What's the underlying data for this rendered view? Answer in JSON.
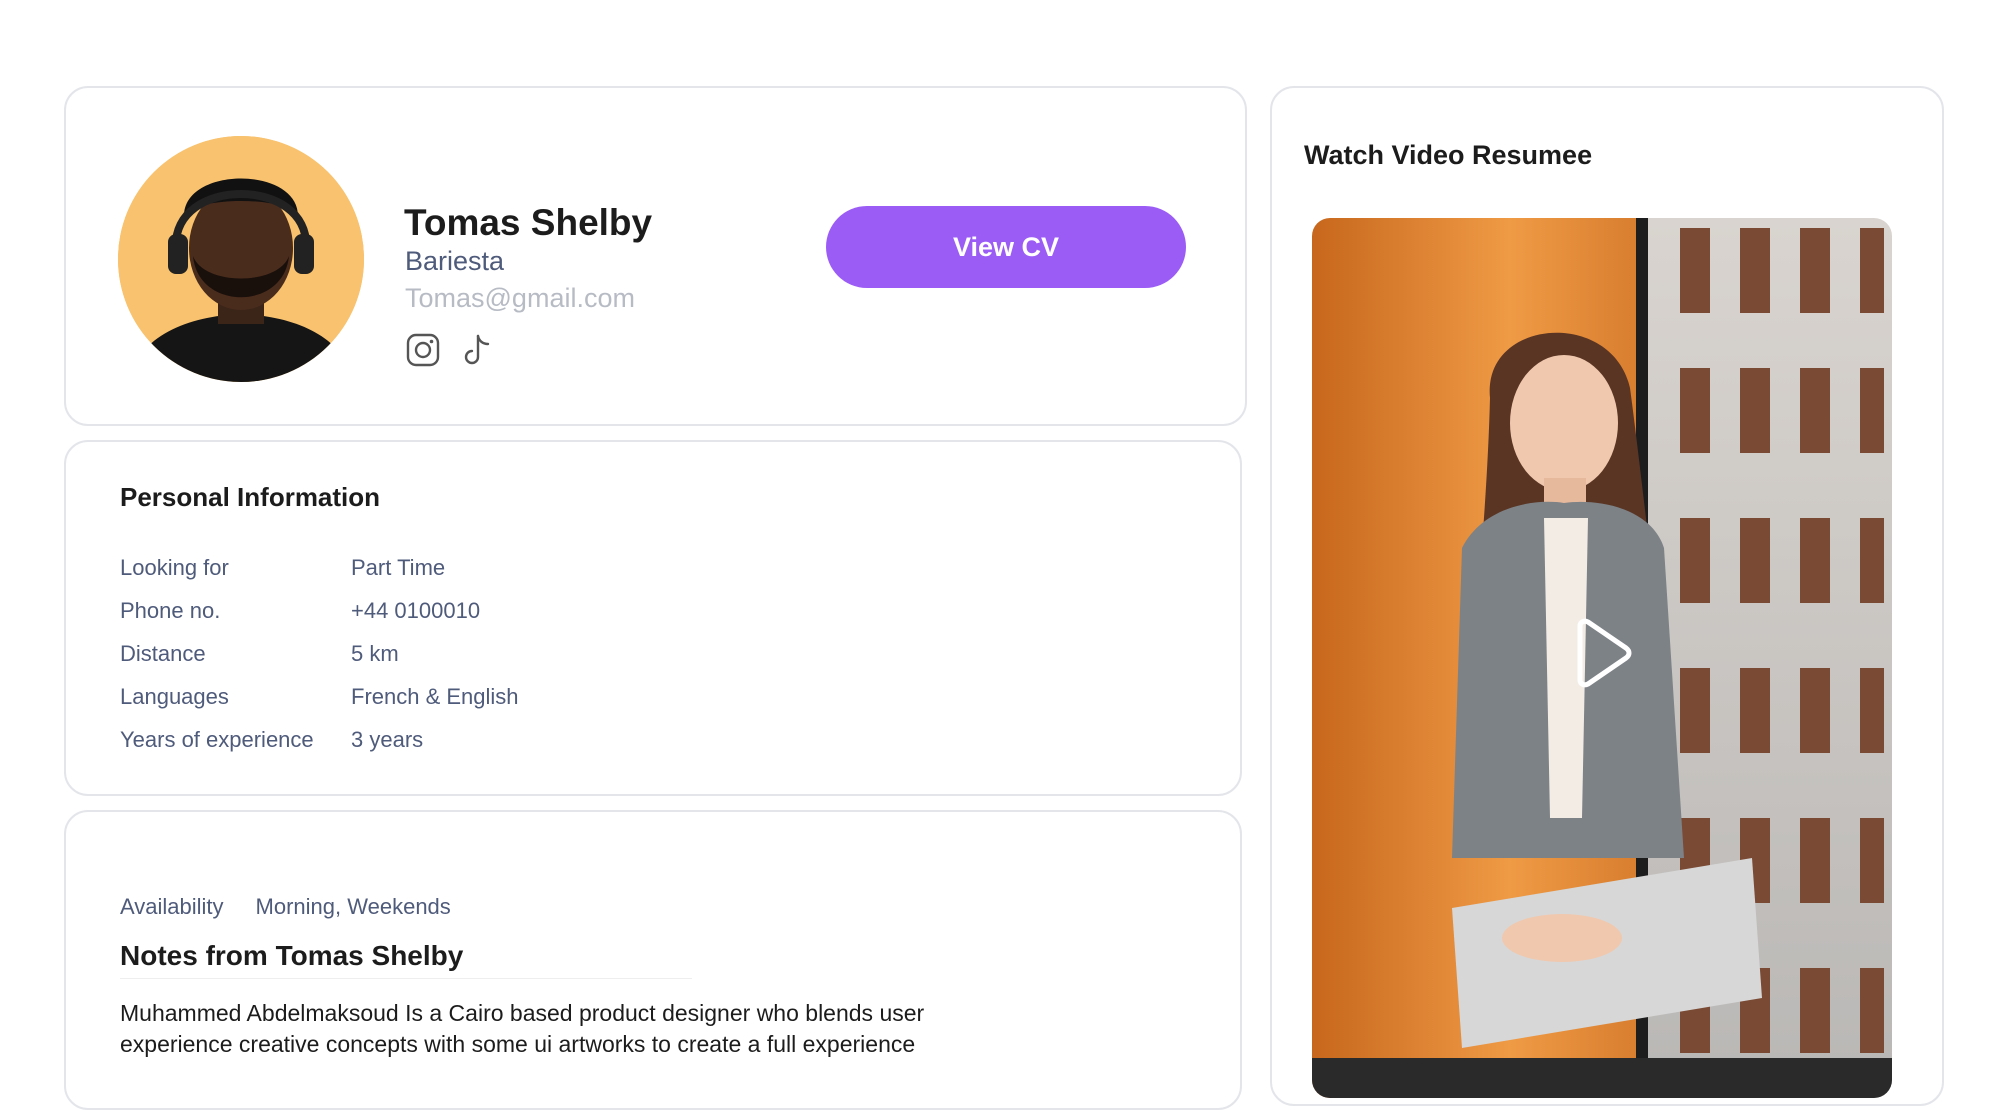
{
  "profile": {
    "name": "Tomas Shelby",
    "role": "Bariesta",
    "email": "Tomas@gmail.com",
    "view_cv_label": "View CV",
    "avatar_icon": "avatar-photo",
    "social_icons": [
      "instagram-icon",
      "tiktok-icon"
    ]
  },
  "personal_info": {
    "title": "Personal Information",
    "rows": [
      {
        "label": "Looking for",
        "value": "Part Time"
      },
      {
        "label": "Phone no.",
        "value": "+44 0100010"
      },
      {
        "label": "Distance",
        "value": "5 km"
      },
      {
        "label": "Languages",
        "value": "French & English"
      },
      {
        "label": "Years of experience",
        "value": "3 years"
      }
    ]
  },
  "notes": {
    "availability_label": "Availability",
    "availability_value": "Morning, Weekends",
    "title": "Notes from Tomas Shelby",
    "body": "Muhammed Abdelmaksoud Is a Cairo based product designer who blends user experience creative concepts with some ui artworks to create a full experience"
  },
  "video": {
    "title": "Watch Video Resumee",
    "play_icon": "play-icon"
  },
  "colors": {
    "accent": "#9b5cf6",
    "muted_text": "#4f5b7b",
    "light_text": "#b7bbc4",
    "card_border": "#e3e5ea",
    "avatar_bg": "#f8c26e"
  }
}
